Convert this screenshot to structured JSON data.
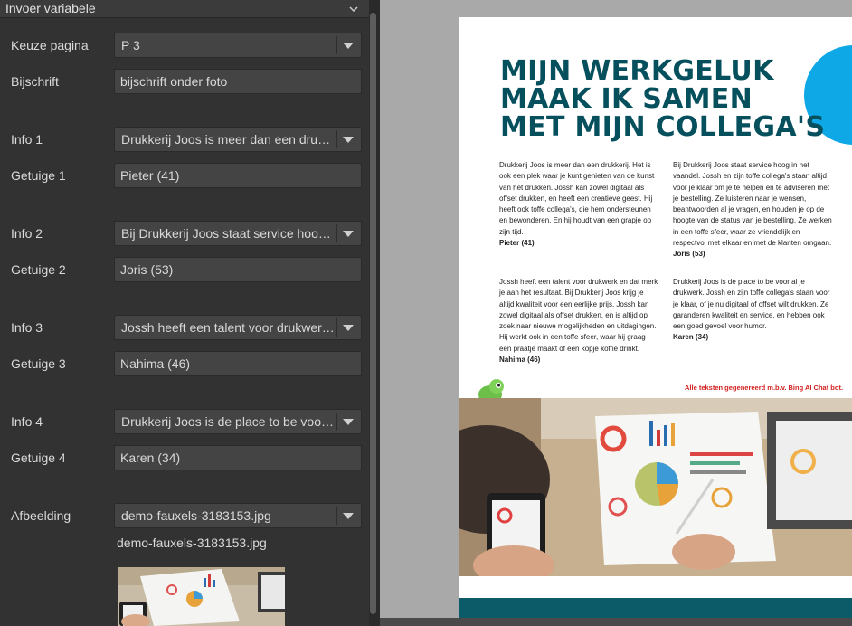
{
  "panel": {
    "title": "Invoer variabele",
    "fields": {
      "keuze_pagina": {
        "label": "Keuze pagina",
        "value": "P 3"
      },
      "bijschrift": {
        "label": "Bijschrift",
        "value": "bijschrift onder foto"
      },
      "info1": {
        "label": "Info 1",
        "value": "Drukkerij Joos is meer dan een drukkeri..."
      },
      "getuige1": {
        "label": "Getuige 1",
        "value": "Pieter (41)"
      },
      "info2": {
        "label": "Info 2",
        "value": "Bij Drukkerij Joos staat service hoog in..."
      },
      "getuige2": {
        "label": "Getuige 2",
        "value": "Joris (53)"
      },
      "info3": {
        "label": "Info 3",
        "value": "Jossh heeft een talent voor drukwerk e..."
      },
      "getuige3": {
        "label": "Getuige 3",
        "value": "Nahima (46)"
      },
      "info4": {
        "label": "Info 4",
        "value": "Drukkerij Joos is de place to be voor al j..."
      },
      "getuige4": {
        "label": "Getuige 4",
        "value": "Karen (34)"
      },
      "afbeelding": {
        "label": "Afbeelding",
        "value": "demo-fauxels-3183153.jpg"
      }
    },
    "image_caption": "demo-fauxels-3183153.jpg"
  },
  "preview": {
    "headline": [
      "MIJN WERKGELUK",
      "MAAK IK SAMEN",
      "MET MIJN COLLEGA'S"
    ],
    "col1_p1": "Drukkerij Joos is meer dan een drukkerij. Het is ook een plek waar je kunt genieten van de kunst van het drukken. Jossh kan zowel digitaal als offset drukken, en heeft een creatieve geest. Hij heeft ook toffe collega's, die hem ondersteunen en bewonderen. En hij houdt van een grapje op zijn tijd.",
    "col1_n1": "Pieter (41)",
    "col1_p2": "Jossh heeft een talent voor drukwerk en dat merk je aan het resultaat. Bij Drukkerij Joos krijg je altijd kwaliteit voor een eerlijke prijs. Jossh kan zowel digitaal als offset drukken, en is altijd op zoek naar nieuwe mogelijkheden en uitdagingen. Hij werkt ook in een toffe sfeer, waar hij graag een praatje maakt of een kopje koffie drinkt.",
    "col1_n2": "Nahima (46)",
    "col2_p1": "Bij Drukkerij Joos staat service hoog in het vaandel. Jossh en zijn toffe collega's staan altijd voor je klaar om je te helpen en te adviseren met je bestelling. Ze luisteren naar je wensen, beantwoorden al je vragen, en houden je op de hoogte van de status van je bestelling. Ze werken in een toffe sfeer, waar ze vriendelijk en respectvol met elkaar en met de klanten omgaan.",
    "col2_n1": "Joris (53)",
    "col2_p2": "Drukkerij Joos is de place to be voor al je drukwerk. Jossh en zijn toffe collega's staan voor je klaar, of je nu digitaal of offset wilt drukken. Ze garanderen kwaliteit en service, en hebben ook een goed gevoel voor humor.",
    "col2_n2": "Karen (34)",
    "credits": "Alle teksten gegenereerd m.b.v. Bing AI Chat bot.",
    "colors": {
      "headline": "#06505e",
      "circle": "#0fa8e6",
      "teal_bar": "#0b5b68",
      "credits": "#d42020"
    }
  },
  "icons": {
    "collapse": "chevron-down-icon",
    "dropdown": "caret-down-icon",
    "mascot": "chameleon-icon"
  }
}
